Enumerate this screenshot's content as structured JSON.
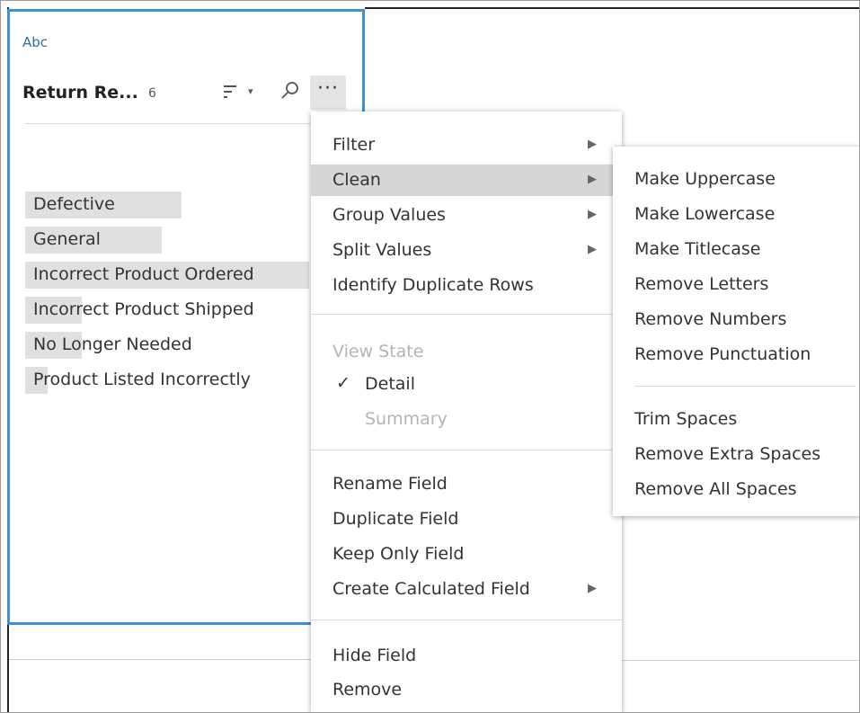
{
  "field": {
    "type_label": "Abc",
    "name": "Return Re...",
    "count": "6",
    "values": [
      {
        "label": "Defective",
        "fill": 0.55
      },
      {
        "label": "General",
        "fill": 0.48
      },
      {
        "label": "Incorrect Product Ordered",
        "fill": 1.0
      },
      {
        "label": "Incorrect Product Shipped",
        "fill": 0.2
      },
      {
        "label": "No Longer Needed",
        "fill": 0.2
      },
      {
        "label": "Product Listed Incorrectly",
        "fill": 0.08
      }
    ]
  },
  "menu": {
    "items": [
      {
        "label": "Filter",
        "submenu": true
      },
      {
        "label": "Clean",
        "submenu": true,
        "active": true
      },
      {
        "label": "Group Values",
        "submenu": true
      },
      {
        "label": "Split Values",
        "submenu": true
      },
      {
        "label": "Identify Duplicate Rows"
      }
    ],
    "view_state_label": "View State",
    "detail_label": "Detail",
    "detail_check": "✓",
    "summary_label": "Summary",
    "field_items": [
      {
        "label": "Rename Field"
      },
      {
        "label": "Duplicate Field"
      },
      {
        "label": "Keep Only Field"
      },
      {
        "label": "Create Calculated Field",
        "submenu": true
      }
    ],
    "bottom_items": [
      {
        "label": "Hide Field"
      },
      {
        "label": "Remove"
      }
    ]
  },
  "clean_submenu": {
    "case_items": [
      "Make Uppercase",
      "Make Lowercase",
      "Make Titlecase",
      "Remove Letters",
      "Remove Numbers",
      "Remove Punctuation"
    ],
    "space_items": [
      "Trim Spaces",
      "Remove Extra Spaces",
      "Remove All Spaces"
    ]
  },
  "icons": {
    "sort": "sort-icon",
    "sort_caret": "caret-down-icon",
    "search": "search-icon",
    "more": "more-options-icon",
    "submenu_arrow": "caret-right-icon",
    "checkmark": "check-icon"
  },
  "colors": {
    "accent": "#3d8fd6",
    "active_row": "#d6d6d6",
    "value_bar": "#e0e0e0",
    "disabled_text": "#b4b4b4"
  }
}
